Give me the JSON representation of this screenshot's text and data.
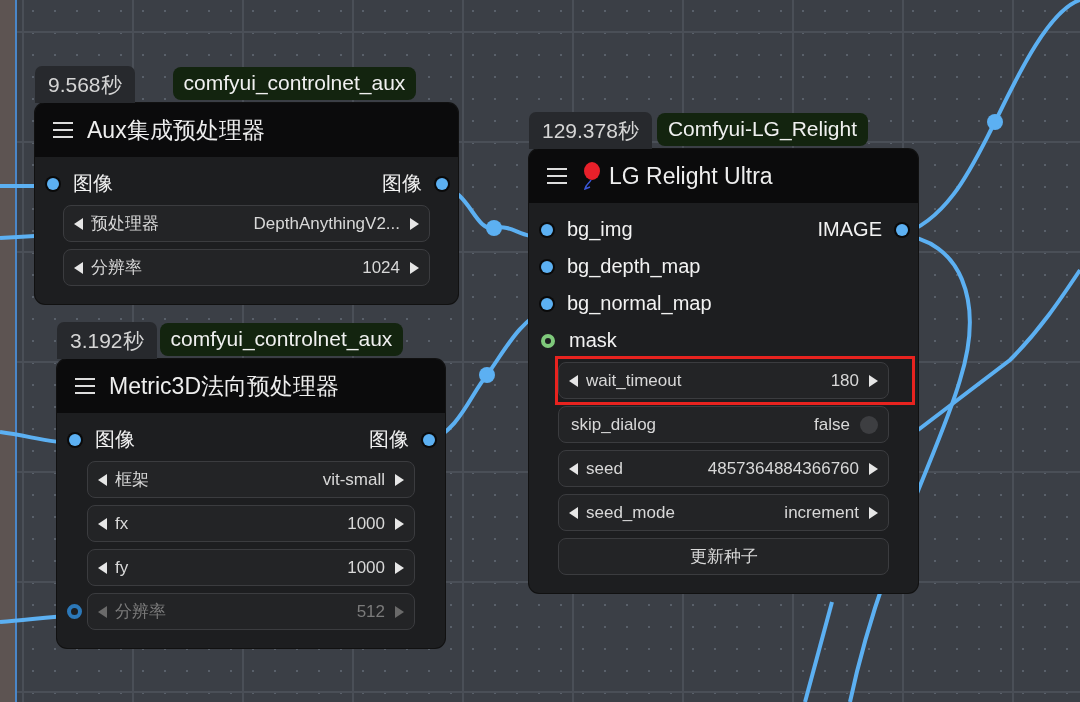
{
  "nodes": [
    {
      "time": "9.568秒",
      "source": "comfyui_controlnet_aux",
      "title": "Aux集成预处理器",
      "title_icon": false,
      "inputs": [
        {
          "label": "图像",
          "kind": "image"
        }
      ],
      "outputs": [
        {
          "label": "图像",
          "kind": "image"
        }
      ],
      "widgets": [
        {
          "kind": "stepper",
          "label": "预处理器",
          "value": "DepthAnythingV2...",
          "disabled": false,
          "linked": false,
          "highlighted": false
        },
        {
          "kind": "stepper",
          "label": "分辨率",
          "value": "1024",
          "disabled": false,
          "linked": false,
          "highlighted": false
        }
      ]
    },
    {
      "time": "3.192秒",
      "source": "comfyui_controlnet_aux",
      "title": "Metric3D法向预处理器",
      "title_icon": false,
      "inputs": [
        {
          "label": "图像",
          "kind": "image"
        }
      ],
      "outputs": [
        {
          "label": "图像",
          "kind": "image"
        }
      ],
      "widgets": [
        {
          "kind": "stepper",
          "label": "框架",
          "value": "vit-small",
          "disabled": false,
          "linked": false,
          "highlighted": false
        },
        {
          "kind": "stepper",
          "label": "fx",
          "value": "1000",
          "disabled": false,
          "linked": false,
          "highlighted": false
        },
        {
          "kind": "stepper",
          "label": "fy",
          "value": "1000",
          "disabled": false,
          "linked": false,
          "highlighted": false
        },
        {
          "kind": "stepper",
          "label": "分辨率",
          "value": "512",
          "disabled": true,
          "linked": true,
          "highlighted": false
        }
      ]
    },
    {
      "time": "129.378秒",
      "source": "Comfyui-LG_Relight",
      "title": "LG Relight Ultra",
      "title_icon": true,
      "inputs": [
        {
          "label": "bg_img",
          "kind": "image"
        },
        {
          "label": "bg_depth_map",
          "kind": "image"
        },
        {
          "label": "bg_normal_map",
          "kind": "image"
        },
        {
          "label": "mask",
          "kind": "mask"
        }
      ],
      "outputs": [
        {
          "label": "IMAGE",
          "kind": "image"
        }
      ],
      "widgets": [
        {
          "kind": "stepper",
          "label": "wait_timeout",
          "value": "180",
          "disabled": false,
          "linked": false,
          "highlighted": true
        },
        {
          "kind": "toggle",
          "label": "skip_dialog",
          "value": "false",
          "on": false,
          "disabled": false,
          "linked": false,
          "highlighted": false
        },
        {
          "kind": "stepper",
          "label": "seed",
          "value": "4857364884366760",
          "disabled": false,
          "linked": false,
          "highlighted": false
        },
        {
          "kind": "stepper",
          "label": "seed_mode",
          "value": "increment",
          "disabled": false,
          "linked": false,
          "highlighted": false
        },
        {
          "kind": "button",
          "label": "更新种子",
          "disabled": false,
          "linked": false,
          "highlighted": false
        }
      ]
    }
  ]
}
